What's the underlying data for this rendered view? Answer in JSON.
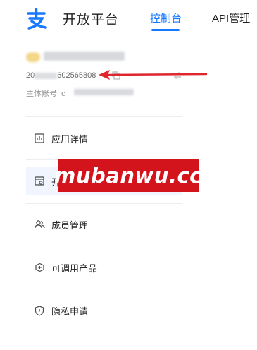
{
  "header": {
    "brand": "开放平台",
    "tabs": [
      {
        "label": "控制台",
        "active": true
      },
      {
        "label": "API管理",
        "active": false
      }
    ],
    "accent_color": "#1677ff"
  },
  "app": {
    "id_prefix": "20",
    "id_suffix": "602565808",
    "owner_label": "主体账号: c"
  },
  "menu": {
    "items": [
      {
        "label": "应用详情",
        "icon": "document-chart-icon",
        "active": false
      },
      {
        "label": "开",
        "icon": "browser-settings-icon",
        "active": true
      },
      {
        "label": "成员管理",
        "icon": "users-icon",
        "active": false
      },
      {
        "label": "可调用产品",
        "icon": "package-icon",
        "active": false
      },
      {
        "label": "隐私申请",
        "icon": "shield-icon",
        "active": false
      }
    ]
  },
  "watermark": {
    "text": "mubanwu.cc",
    "color": "#d4141d"
  },
  "annotation": {
    "arrow_color": "#e0262c"
  }
}
